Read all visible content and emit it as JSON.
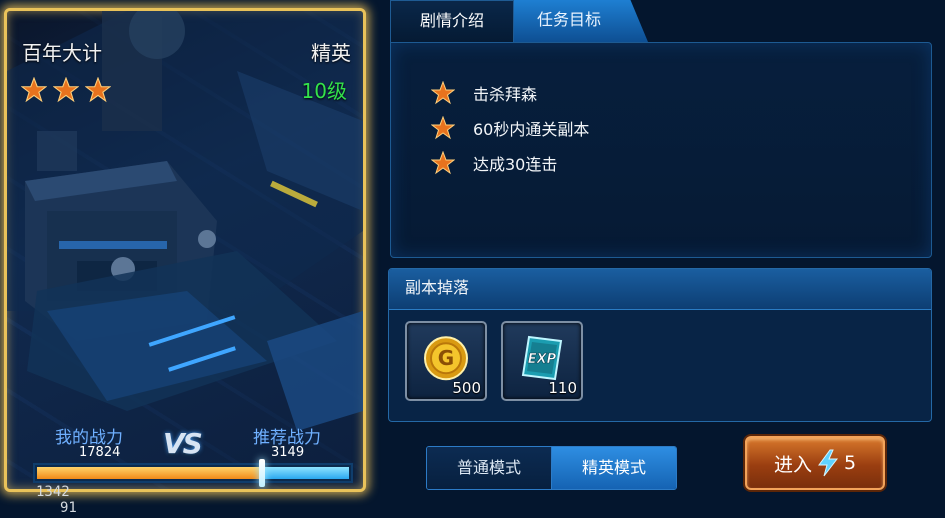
{
  "mission_card": {
    "title": "百年大计",
    "difficulty": "精英",
    "level": "10级",
    "stars_earned": 3,
    "my_power_label": "我的战力",
    "my_power_value": "17824",
    "vs_text": "VS",
    "recommended_power_label": "推荐战力",
    "recommended_power_value": "3149",
    "power_bar_fraction": 0.72
  },
  "tabs": [
    {
      "label": "剧情介绍",
      "active": false
    },
    {
      "label": "任务目标",
      "active": true
    }
  ],
  "goals": [
    {
      "text": "击杀拜森",
      "icon": "star-icon"
    },
    {
      "text": "60秒内通关副本",
      "icon": "star-icon"
    },
    {
      "text": "达成30连击",
      "icon": "star-icon"
    }
  ],
  "drops": {
    "header": "副本掉落",
    "items": [
      {
        "icon": "gold-coin-icon",
        "quantity": "500"
      },
      {
        "icon": "exp-card-icon",
        "quantity": "110"
      }
    ]
  },
  "modes": {
    "normal_label": "普通模式",
    "elite_label": "精英模式",
    "selected": "elite"
  },
  "enter_button": {
    "label": "进入",
    "icon": "energy-bolt-icon",
    "cost": "5"
  },
  "debug": {
    "line1": "1342",
    "line2": "91"
  },
  "colors": {
    "card_border": "#e9c25a",
    "level_green": "#33e24a",
    "tab_active": "#1e7fd2",
    "enter_orange": "#d8782c",
    "star_orange": "#e8731e"
  }
}
